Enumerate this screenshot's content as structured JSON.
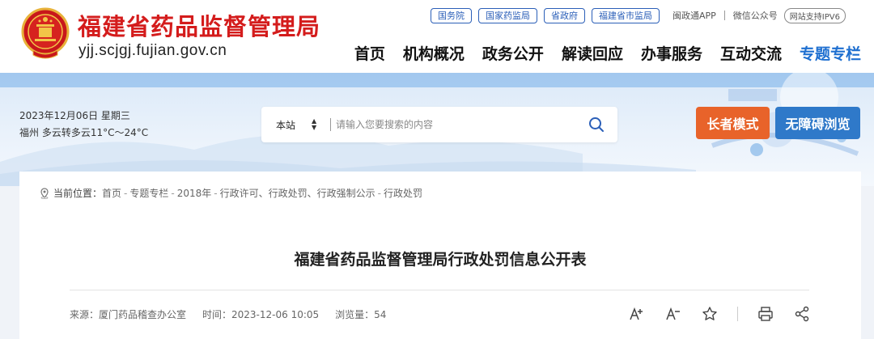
{
  "header": {
    "site_title": "福建省药品监督管理局",
    "site_domain": "yjj.scjgj.fujian.gov.cn",
    "top_links": [
      "国务院",
      "国家药监局",
      "省政府",
      "福建省市监局"
    ],
    "app_link": "闽政通APP",
    "wechat_link": "微信公众号",
    "ipv6_badge": "网站支持IPV6",
    "nav": [
      "首页",
      "机构概况",
      "政务公开",
      "解读回应",
      "办事服务",
      "互动交流",
      "专题专栏"
    ],
    "active_nav_index": 6
  },
  "banner": {
    "date": "2023年12月06日 星期三",
    "weather": "福州 多云转多云11°C～24°C",
    "search": {
      "scope": "本站",
      "placeholder": "请输入您要搜索的内容"
    },
    "elder_mode": "长者模式",
    "accessible_mode": "无障碍浏览"
  },
  "breadcrumb": {
    "label": "当前位置：",
    "items": [
      "首页",
      "专题专栏",
      "2018年",
      "行政许可、行政处罚、行政强制公示",
      "行政处罚"
    ],
    "separator": "-"
  },
  "article": {
    "title": "福建省药品监督管理局行政处罚信息公开表",
    "source": "来源：厦门药品稽查办公室",
    "time": "时间：2023-12-06 10:05",
    "views": "浏览量：54"
  },
  "tools": [
    "font-increase-icon",
    "font-decrease-icon",
    "star-icon",
    "print-icon",
    "share-icon"
  ],
  "colors": {
    "title_red": "#d41c1c",
    "nav_active": "#1e6fd0",
    "link_blue": "#2b5fb8",
    "elder_orange": "#e8632a",
    "access_blue": "#2f79c9"
  }
}
